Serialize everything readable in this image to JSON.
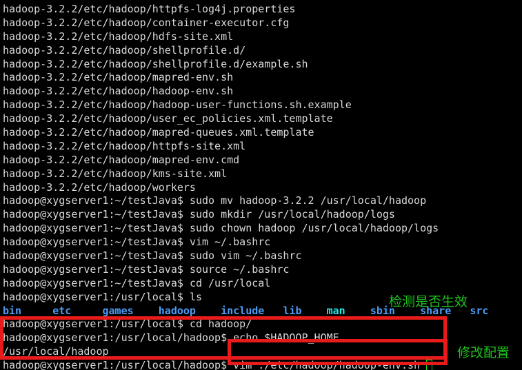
{
  "terminal": {
    "prompt_testjava": "hadoop@xygserver1:~/testJava$ ",
    "prompt_local": "hadoop@xygserver1:/usr/local$ ",
    "prompt_hadoop": "hadoop@xygserver1:/usr/local/hadoop$ ",
    "lines": [
      {
        "id": "tar-out-1",
        "text": "hadoop-3.2.2/etc/hadoop/httpfs-log4j.properties"
      },
      {
        "id": "tar-out-2",
        "text": "hadoop-3.2.2/etc/hadoop/container-executor.cfg"
      },
      {
        "id": "tar-out-3",
        "text": "hadoop-3.2.2/etc/hadoop/hdfs-site.xml"
      },
      {
        "id": "tar-out-4",
        "text": "hadoop-3.2.2/etc/hadoop/shellprofile.d/"
      },
      {
        "id": "tar-out-5",
        "text": "hadoop-3.2.2/etc/hadoop/shellprofile.d/example.sh"
      },
      {
        "id": "tar-out-6",
        "text": "hadoop-3.2.2/etc/hadoop/mapred-env.sh"
      },
      {
        "id": "tar-out-7",
        "text": "hadoop-3.2.2/etc/hadoop/hadoop-env.sh"
      },
      {
        "id": "tar-out-8",
        "text": "hadoop-3.2.2/etc/hadoop/hadoop-user-functions.sh.example"
      },
      {
        "id": "tar-out-9",
        "text": "hadoop-3.2.2/etc/hadoop/user_ec_policies.xml.template"
      },
      {
        "id": "tar-out-10",
        "text": "hadoop-3.2.2/etc/hadoop/mapred-queues.xml.template"
      },
      {
        "id": "tar-out-11",
        "text": "hadoop-3.2.2/etc/hadoop/httpfs-site.xml"
      },
      {
        "id": "tar-out-12",
        "text": "hadoop-3.2.2/etc/hadoop/mapred-env.cmd"
      },
      {
        "id": "tar-out-13",
        "text": "hadoop-3.2.2/etc/hadoop/kms-site.xml"
      },
      {
        "id": "tar-out-14",
        "text": "hadoop-3.2.2/etc/hadoop/workers"
      },
      {
        "id": "cmd-mv",
        "prompt": "hadoop@xygserver1:~/testJava$ ",
        "command": "sudo mv hadoop-3.2.2 /usr/local/hadoop"
      },
      {
        "id": "cmd-mkdir",
        "prompt": "hadoop@xygserver1:~/testJava$ ",
        "command": "sudo mkdir /usr/local/hadoop/logs"
      },
      {
        "id": "cmd-chown",
        "prompt": "hadoop@xygserver1:~/testJava$ ",
        "command": "sudo chown hadoop /usr/local/hadoop/logs"
      },
      {
        "id": "cmd-vim-bashrc",
        "prompt": "hadoop@xygserver1:~/testJava$ ",
        "command": "vim ~/.bashrc"
      },
      {
        "id": "cmd-sudo-vim-bashrc",
        "prompt": "hadoop@xygserver1:~/testJava$ ",
        "command": "sudo vim ~/.bashrc"
      },
      {
        "id": "cmd-source",
        "prompt": "hadoop@xygserver1:~/testJava$ ",
        "command": "source ~/.bashrc"
      },
      {
        "id": "cmd-cd-local",
        "prompt": "hadoop@xygserver1:~/testJava$ ",
        "command": "cd /usr/local"
      },
      {
        "id": "cmd-ls",
        "prompt": "hadoop@xygserver1:/usr/local$ ",
        "command": "ls"
      }
    ],
    "ls_output": [
      {
        "name": "bin",
        "type": "dir"
      },
      {
        "name": "etc",
        "type": "dir"
      },
      {
        "name": "games",
        "type": "dir"
      },
      {
        "name": "hadoop",
        "type": "dir"
      },
      {
        "name": "include",
        "type": "dir"
      },
      {
        "name": "lib",
        "type": "dir"
      },
      {
        "name": "man",
        "type": "link"
      },
      {
        "name": "sbin",
        "type": "dir"
      },
      {
        "name": "share",
        "type": "dir"
      },
      {
        "name": "src",
        "type": "dir"
      }
    ],
    "cmd_cd_hadoop": {
      "prompt": "hadoop@xygserver1:/usr/local$ ",
      "command": "cd hadoop/"
    },
    "cmd_echo": {
      "prompt": "hadoop@xygserver1:/usr/local/hadoop$ ",
      "command": "echo $HADOOP_HOME"
    },
    "echo_output": "/usr/local/hadoop",
    "cmd_vim": {
      "prompt": "hadoop@xygserver1:/usr/local/hadoop$ ",
      "command": "vim ./etc/hadoop/hadoop-env.sh "
    }
  },
  "annotations": {
    "box_color": "#e81b1b",
    "text_color": "#1ec21e",
    "check_label": "检测是否生效",
    "modify_label": "修改配置"
  }
}
